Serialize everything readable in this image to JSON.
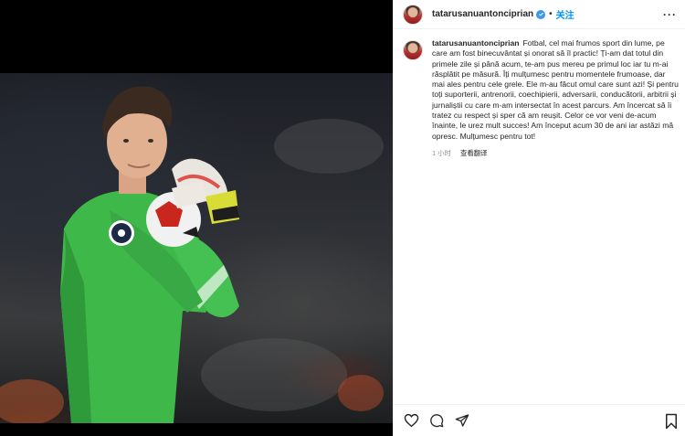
{
  "post": {
    "username": "tatarusanuantonciprian",
    "follow_label": "关注",
    "more_label": "···",
    "caption_text": "Fotbal, cel mai frumos sport din lume, pe care am fost binecuvântat și onorat să îl practic! Ți-am dat totul din primele zile și până acum, te-am pus mereu pe primul loc iar tu m-ai răsplătit pe măsură. Îți mulțumesc pentru momentele frumoase, dar mai ales pentru cele grele. Ele m-au făcut omul care sunt azi! Și pentru toți suporterii, antrenorii, coechipierii, adversarii, conducătorii, arbitrii și jurnaliștii cu care m-am intersectat în acest parcurs. Am încercat să îi tratez cu respect și sper că am reușit. Celor ce vor veni de-acum înainte, le urez mult succes!  Am început acum 30 de ani iar astăzi mă opresc. Mulțumesc pentru tot!",
    "timestamp": "1 小时",
    "translate_label": "查看翻译"
  },
  "icons": {
    "like": "heart-icon",
    "comment": "comment-icon",
    "share": "paper-plane-icon",
    "save": "bookmark-icon",
    "verified": "verified-badge-icon"
  },
  "colors": {
    "accent": "#0095f6",
    "verified": "#3897f0",
    "jersey": "#3fb84a"
  }
}
